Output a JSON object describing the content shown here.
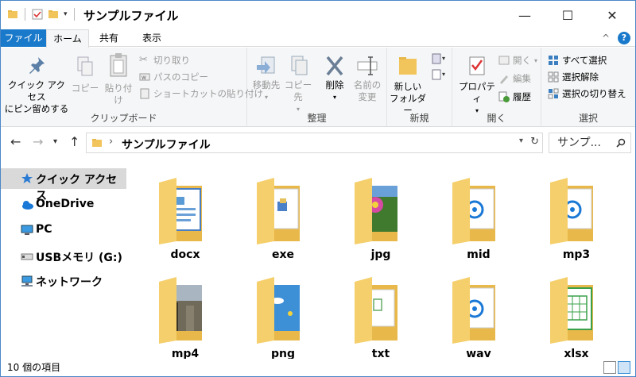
{
  "window": {
    "title": "サンプルファイル",
    "controls": {
      "minimize": "—",
      "maximize": "☐",
      "close": "✕"
    }
  },
  "ribbon_tabs": {
    "file": "ファイル",
    "home": "ホーム",
    "share": "共有",
    "view": "表示",
    "collapse": "^",
    "help": "?"
  },
  "ribbon": {
    "clipboard": {
      "label": "クリップボード",
      "pin_line1": "クイック アクセス",
      "pin_line2": "にピン留めする",
      "copy": "コピー",
      "paste": "貼り付け",
      "cut": "切り取り",
      "copy_path": "パスのコピー",
      "paste_shortcut": "ショートカットの貼り付け"
    },
    "organize": {
      "label": "整理",
      "move_to": "移動先",
      "copy_to": "コピー先",
      "delete": "削除",
      "rename_line1": "名前の",
      "rename_line2": "変更"
    },
    "new": {
      "label": "新規",
      "new_folder_line1": "新しい",
      "new_folder_line2": "フォルダー"
    },
    "open": {
      "label": "開く",
      "properties": "プロパティ",
      "open": "開く",
      "edit": "編集",
      "history": "履歴"
    },
    "select": {
      "label": "選択",
      "select_all": "すべて選択",
      "select_none": "選択解除",
      "invert": "選択の切り替え"
    }
  },
  "address": {
    "path": "サンプルファイル",
    "search_placeholder": "サンプ..."
  },
  "nav_pane": {
    "items": [
      {
        "label": "クイック アクセス",
        "icon": "star-icon"
      },
      {
        "label": "OneDrive",
        "icon": "cloud-icon"
      },
      {
        "label": "PC",
        "icon": "pc-icon"
      },
      {
        "label": "USBメモリ (G:)",
        "icon": "usb-drive-icon"
      },
      {
        "label": "ネットワーク",
        "icon": "network-icon"
      }
    ]
  },
  "folders": [
    {
      "name": "docx",
      "preview": "document"
    },
    {
      "name": "exe",
      "preview": "installer"
    },
    {
      "name": "jpg",
      "preview": "photo"
    },
    {
      "name": "mid",
      "preview": "audio"
    },
    {
      "name": "mp3",
      "preview": "audio"
    },
    {
      "name": "mp4",
      "preview": "video"
    },
    {
      "name": "png",
      "preview": "image"
    },
    {
      "name": "txt",
      "preview": "text"
    },
    {
      "name": "wav",
      "preview": "audio"
    },
    {
      "name": "xlsx",
      "preview": "spreadsheet"
    }
  ],
  "status": {
    "item_count": "10 個の項目"
  },
  "colors": {
    "accent": "#1979ca",
    "folder": "#f5cf6b",
    "folder_dark": "#e8b84a"
  }
}
